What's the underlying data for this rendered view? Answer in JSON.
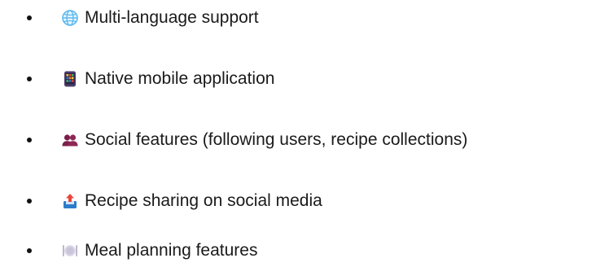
{
  "features": [
    {
      "icon": "globe-icon",
      "label": "Multi-language support"
    },
    {
      "icon": "mobile-app-icon",
      "label": "Native mobile application"
    },
    {
      "icon": "people-icon",
      "label": "Social features (following users, recipe collections)"
    },
    {
      "icon": "share-outbox-icon",
      "label": "Recipe sharing on social media"
    },
    {
      "icon": "plate-cutlery-icon",
      "label": "Meal planning features"
    }
  ],
  "colors": {
    "text": "#1a1a1a",
    "globe": "#5bb8ef",
    "people": "#7b1f4a",
    "share_arrow": "#e8463b",
    "share_tray": "#2b7cc9",
    "plate": "#c9c4d8"
  }
}
